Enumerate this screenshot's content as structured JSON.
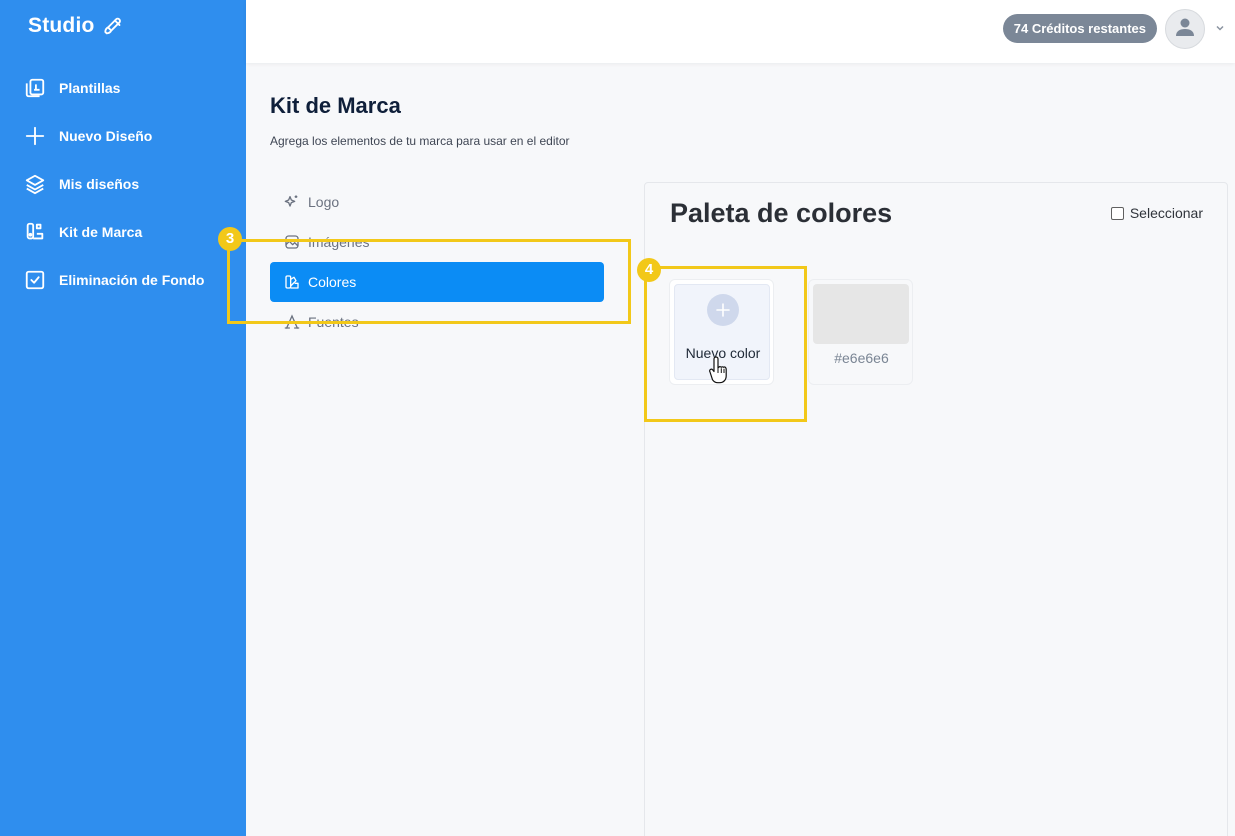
{
  "sidebar": {
    "brand": "Studio",
    "items": [
      {
        "label": "Plantillas",
        "icon": "templates-icon"
      },
      {
        "label": "Nuevo Diseño",
        "icon": "plus-icon"
      },
      {
        "label": "Mis diseños",
        "icon": "layers-icon"
      },
      {
        "label": "Kit de Marca",
        "icon": "brand-kit-icon"
      },
      {
        "label": "Eliminación de Fondo",
        "icon": "checkbox-icon"
      }
    ]
  },
  "topbar": {
    "credits": "74 Créditos restantes",
    "avatar_icon": "user-icon",
    "chevron_icon": "chevron-down-icon"
  },
  "header": {
    "title": "Kit de Marca",
    "subtitle": "Agrega los elementos de tu marca para usar en el editor"
  },
  "subnav": {
    "items": [
      {
        "label": "Logo",
        "icon": "sparkle-icon"
      },
      {
        "label": "Imágenes",
        "icon": "image-icon"
      },
      {
        "label": "Colores",
        "icon": "palette-icon",
        "active": true
      },
      {
        "label": "Fuentes",
        "icon": "font-icon"
      }
    ]
  },
  "panel": {
    "title": "Paleta de colores",
    "select_label": "Seleccionar",
    "new_color_label": "Nuevo color",
    "colors": [
      {
        "hex": "#e6e6e6",
        "label": "#e6e6e6"
      }
    ]
  },
  "annotations": {
    "step3": "3",
    "step4": "4"
  },
  "theme": {
    "sidebar_bg": "#2f8eee",
    "active_bg": "#0b8cf5",
    "highlight": "#f2c819"
  }
}
